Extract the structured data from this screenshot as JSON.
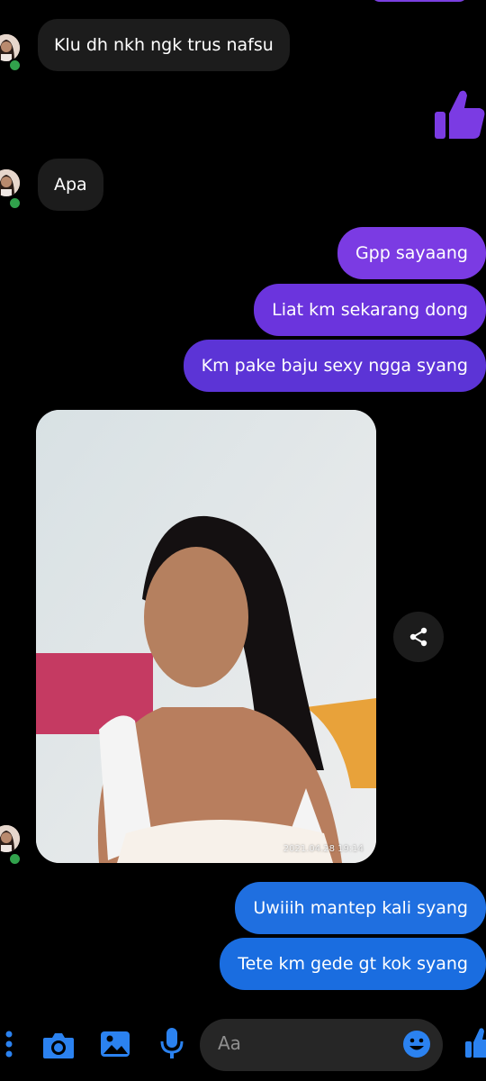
{
  "colors": {
    "outgoing_purple": "#7b3be3",
    "outgoing_blue": "#1f6fe0",
    "incoming_gray": "#1c1c1c",
    "accent_blue": "#2b82f0",
    "online_green": "#31a24c"
  },
  "messages": [
    {
      "direction": "incoming",
      "text": "Klu dh nkh ngk trus nafsu"
    },
    {
      "direction": "outgoing",
      "type": "like",
      "icon": "thumbs-up-icon"
    },
    {
      "direction": "incoming",
      "text": "Apa"
    },
    {
      "direction": "outgoing",
      "text": "Gpp sayaang"
    },
    {
      "direction": "outgoing",
      "text": "Liat km sekarang dong"
    },
    {
      "direction": "outgoing",
      "text": "Km pake baju sexy ngga syang"
    },
    {
      "direction": "incoming",
      "type": "photo",
      "timestamp": "2021.04.28 19:14"
    },
    {
      "direction": "outgoing",
      "text": "Uwiiih mantep kali syang"
    },
    {
      "direction": "outgoing",
      "text": "Tete km gede gt kok syang"
    }
  ],
  "composer": {
    "placeholder": "Aa",
    "icons": [
      "more-dots-icon",
      "camera-icon",
      "gallery-icon",
      "microphone-icon",
      "emoji-icon",
      "thumbs-up-icon"
    ]
  }
}
